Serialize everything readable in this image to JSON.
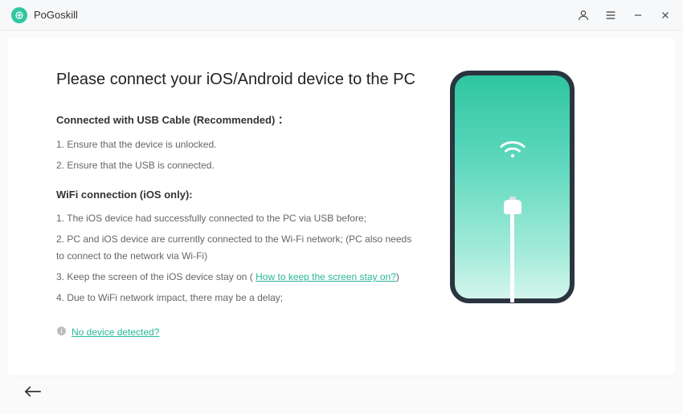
{
  "app": {
    "title": "PoGoskill"
  },
  "heading": "Please connect your iOS/Android device to the PC",
  "usb": {
    "title": "Connected with USB Cable (Recommended) ：",
    "step1": "1. Ensure that the device is unlocked.",
    "step2": "2. Ensure that the USB is connected."
  },
  "wifi": {
    "title": "WiFi connection (iOS only):",
    "step1": "1. The iOS device had successfully connected to the PC via USB before;",
    "step2": "2. PC and iOS device are currently connected to the Wi-Fi network; (PC also needs to connect to the network via Wi-Fi)",
    "step3_prefix": "3. Keep the screen of the iOS device stay on  ( ",
    "step3_link": "How to keep the screen stay on?",
    "step3_suffix": ")",
    "step4": "4. Due to WiFi network impact, there may be a delay;"
  },
  "noDevice": {
    "link": "No device detected?"
  }
}
